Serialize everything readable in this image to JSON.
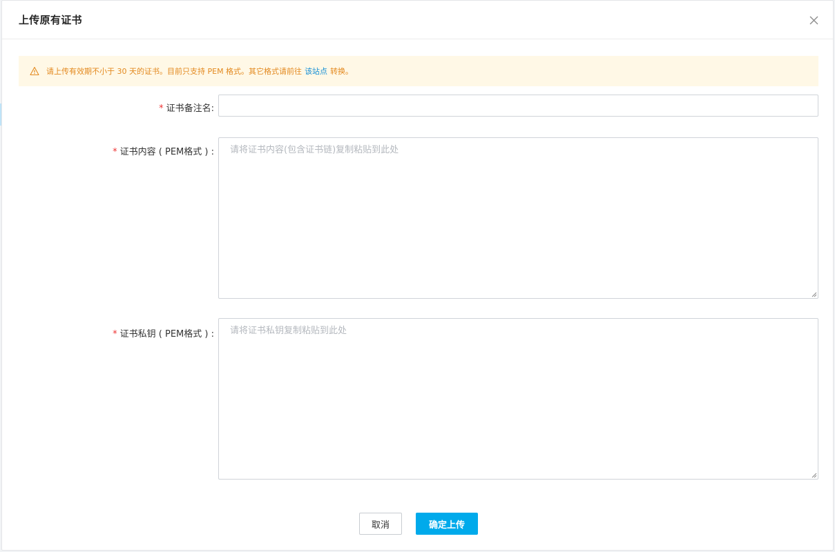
{
  "dialog": {
    "title": "上传原有证书",
    "close_icon": "close-icon"
  },
  "notice": {
    "icon": "warning-icon",
    "text_before": "请上传有效期不小于 30 天的证书。目前只支持 PEM 格式。其它格式请前往",
    "link_text": "该站点",
    "text_after": "转换。",
    "color": "#e3891f",
    "link_color": "#1890d6",
    "background": "#fff8e6"
  },
  "form": {
    "required_mark": "*",
    "name_field": {
      "label": "证书备注名:",
      "value": "",
      "placeholder": ""
    },
    "content_field": {
      "label": "证书内容 ( PEM格式 ) :",
      "value": "",
      "placeholder": "请将证书内容(包含证书链)复制粘贴到此处"
    },
    "private_key_field": {
      "label": "证书私钥 ( PEM格式 ) :",
      "value": "",
      "placeholder": "请将证书私钥复制粘贴到此处"
    }
  },
  "footer": {
    "cancel_label": "取消",
    "confirm_label": "确定上传",
    "confirm_color": "#00aaeb"
  }
}
